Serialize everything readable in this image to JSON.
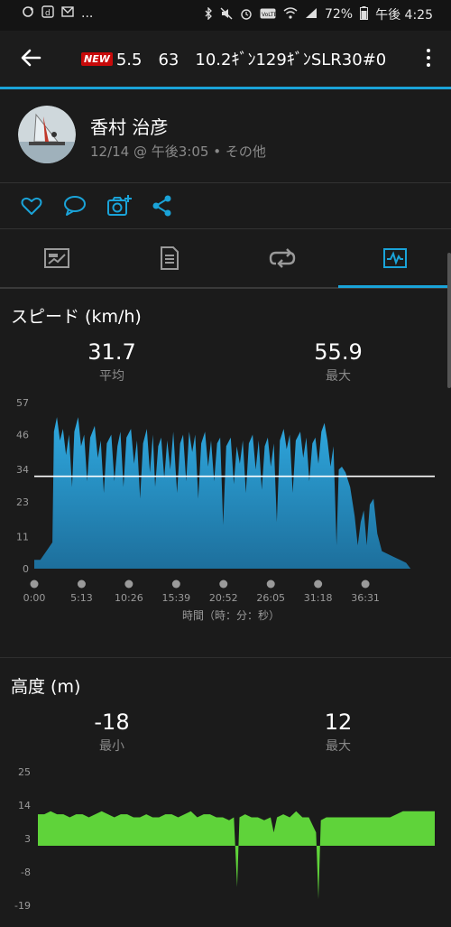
{
  "status_bar": {
    "battery": "72%",
    "time": "午後 4:25",
    "left_icons": [
      "sync-icon",
      "d-icon",
      "mail-icon"
    ],
    "ellipsis": "..."
  },
  "header": {
    "new_badge": "NEW",
    "title": "5.5　63　10.2ｷﾞﾝ129ｷﾞﾝSLR30#0"
  },
  "profile": {
    "name": "香村 治彦",
    "meta": "12/14 @ 午後3:05 • その他"
  },
  "colors": {
    "accent": "#1aa3d8",
    "speed_fill": "#2a97cf",
    "elevation_fill": "#5fd33a"
  },
  "speed": {
    "title": "スピード (km/h)",
    "avg_value": "31.7",
    "avg_label": "平均",
    "max_value": "55.9",
    "max_label": "最大",
    "x_axis_label": "時間（時：分：秒）"
  },
  "elevation": {
    "title": "高度 (m)",
    "min_value": "-18",
    "min_label": "最小",
    "max_value": "12",
    "max_label": "最大"
  },
  "chart_data": [
    {
      "type": "area",
      "ylabel": "",
      "y_ticks": [
        "0",
        "11",
        "23",
        "34",
        "46",
        "57"
      ],
      "ylim": [
        0,
        57
      ],
      "x_ticks": [
        "0:00",
        "5:13",
        "10:26",
        "15:39",
        "20:52",
        "26:05",
        "31:18",
        "36:31"
      ],
      "x_tick_seconds": [
        0,
        313,
        626,
        939,
        1252,
        1565,
        1878,
        2191
      ],
      "xlim_seconds": [
        0,
        2650
      ],
      "average_line": 31.7,
      "series": [
        {
          "points": [
            [
              0,
              3
            ],
            [
              40,
              3
            ],
            [
              80,
              6
            ],
            [
              120,
              9
            ],
            [
              130,
              47
            ],
            [
              150,
              52
            ],
            [
              170,
              44
            ],
            [
              190,
              48
            ],
            [
              210,
              39
            ],
            [
              230,
              46
            ],
            [
              250,
              28
            ],
            [
              265,
              47
            ],
            [
              290,
              52
            ],
            [
              310,
              42
            ],
            [
              330,
              46
            ],
            [
              350,
              30
            ],
            [
              370,
              45
            ],
            [
              400,
              49
            ],
            [
              420,
              38
            ],
            [
              440,
              44
            ],
            [
              460,
              26
            ],
            [
              480,
              43
            ],
            [
              510,
              46
            ],
            [
              530,
              30
            ],
            [
              550,
              42
            ],
            [
              570,
              47
            ],
            [
              590,
              28
            ],
            [
              610,
              45
            ],
            [
              640,
              48
            ],
            [
              660,
              36
            ],
            [
              680,
              44
            ],
            [
              700,
              24
            ],
            [
              720,
              43
            ],
            [
              745,
              48
            ],
            [
              765,
              33
            ],
            [
              785,
              46
            ],
            [
              800,
              28
            ],
            [
              820,
              42
            ],
            [
              840,
              45
            ],
            [
              860,
              31
            ],
            [
              880,
              44
            ],
            [
              900,
              34
            ],
            [
              920,
              47
            ],
            [
              945,
              26
            ],
            [
              965,
              43
            ],
            [
              985,
              46
            ],
            [
              1005,
              30
            ],
            [
              1025,
              47
            ],
            [
              1045,
              40
            ],
            [
              1065,
              46
            ],
            [
              1085,
              24
            ],
            [
              1105,
              43
            ],
            [
              1130,
              47
            ],
            [
              1150,
              35
            ],
            [
              1170,
              44
            ],
            [
              1190,
              30
            ],
            [
              1210,
              43
            ],
            [
              1230,
              45
            ],
            [
              1250,
              15
            ],
            [
              1270,
              42
            ],
            [
              1300,
              45
            ],
            [
              1320,
              29
            ],
            [
              1340,
              42
            ],
            [
              1360,
              36
            ],
            [
              1380,
              44
            ],
            [
              1400,
              26
            ],
            [
              1420,
              43
            ],
            [
              1445,
              46
            ],
            [
              1465,
              34
            ],
            [
              1485,
              44
            ],
            [
              1505,
              27
            ],
            [
              1525,
              42
            ],
            [
              1545,
              45
            ],
            [
              1565,
              35
            ],
            [
              1585,
              43
            ],
            [
              1605,
              16
            ],
            [
              1625,
              44
            ],
            [
              1650,
              48
            ],
            [
              1670,
              41
            ],
            [
              1690,
              46
            ],
            [
              1710,
              26
            ],
            [
              1730,
              44
            ],
            [
              1760,
              47
            ],
            [
              1780,
              38
            ],
            [
              1800,
              45
            ],
            [
              1820,
              30
            ],
            [
              1840,
              43
            ],
            [
              1860,
              45
            ],
            [
              1880,
              36
            ],
            [
              1900,
              47
            ],
            [
              1920,
              50
            ],
            [
              1940,
              44
            ],
            [
              1960,
              35
            ],
            [
              1980,
              42
            ],
            [
              2000,
              8
            ],
            [
              2015,
              34
            ],
            [
              2035,
              35
            ],
            [
              2060,
              33
            ],
            [
              2090,
              28
            ],
            [
              2120,
              18
            ],
            [
              2140,
              8
            ],
            [
              2160,
              16
            ],
            [
              2180,
              20
            ],
            [
              2200,
              8
            ],
            [
              2220,
              22
            ],
            [
              2245,
              24
            ],
            [
              2270,
              12
            ],
            [
              2300,
              6
            ],
            [
              2340,
              5
            ],
            [
              2380,
              4
            ],
            [
              2420,
              3
            ],
            [
              2460,
              2
            ],
            [
              2490,
              0
            ]
          ]
        }
      ]
    },
    {
      "type": "area",
      "ylabel": "",
      "y_ticks": [
        "-19",
        "-8",
        "3",
        "14",
        "25"
      ],
      "ylim": [
        -19,
        25
      ],
      "average_line": null,
      "series": [
        {
          "points": [
            [
              0,
              11
            ],
            [
              40,
              11
            ],
            [
              80,
              12
            ],
            [
              120,
              11
            ],
            [
              160,
              11
            ],
            [
              200,
              10
            ],
            [
              240,
              11
            ],
            [
              280,
              11
            ],
            [
              320,
              10
            ],
            [
              360,
              11
            ],
            [
              400,
              12
            ],
            [
              440,
              11
            ],
            [
              480,
              10
            ],
            [
              520,
              11
            ],
            [
              560,
              11
            ],
            [
              600,
              10
            ],
            [
              640,
              10
            ],
            [
              680,
              11
            ],
            [
              720,
              10
            ],
            [
              760,
              10
            ],
            [
              800,
              11
            ],
            [
              840,
              11
            ],
            [
              880,
              10
            ],
            [
              920,
              11
            ],
            [
              960,
              12
            ],
            [
              1000,
              10
            ],
            [
              1040,
              11
            ],
            [
              1080,
              11
            ],
            [
              1120,
              10
            ],
            [
              1160,
              10
            ],
            [
              1200,
              9
            ],
            [
              1230,
              10
            ],
            [
              1250,
              -13
            ],
            [
              1265,
              10
            ],
            [
              1300,
              11
            ],
            [
              1340,
              10
            ],
            [
              1380,
              10
            ],
            [
              1420,
              9
            ],
            [
              1460,
              10
            ],
            [
              1480,
              5
            ],
            [
              1500,
              10
            ],
            [
              1540,
              11
            ],
            [
              1580,
              10
            ],
            [
              1620,
              12
            ],
            [
              1660,
              10
            ],
            [
              1700,
              10
            ],
            [
              1745,
              5
            ],
            [
              1760,
              -17
            ],
            [
              1775,
              9
            ],
            [
              1810,
              10
            ],
            [
              1850,
              10
            ],
            [
              1890,
              10
            ],
            [
              1930,
              10
            ],
            [
              1970,
              10
            ],
            [
              2010,
              10
            ],
            [
              2050,
              10
            ],
            [
              2090,
              10
            ],
            [
              2130,
              10
            ],
            [
              2170,
              10
            ],
            [
              2210,
              10
            ],
            [
              2250,
              11
            ],
            [
              2290,
              12
            ],
            [
              2330,
              12
            ],
            [
              2370,
              12
            ],
            [
              2410,
              12
            ],
            [
              2450,
              12
            ],
            [
              2490,
              12
            ]
          ]
        }
      ]
    }
  ]
}
